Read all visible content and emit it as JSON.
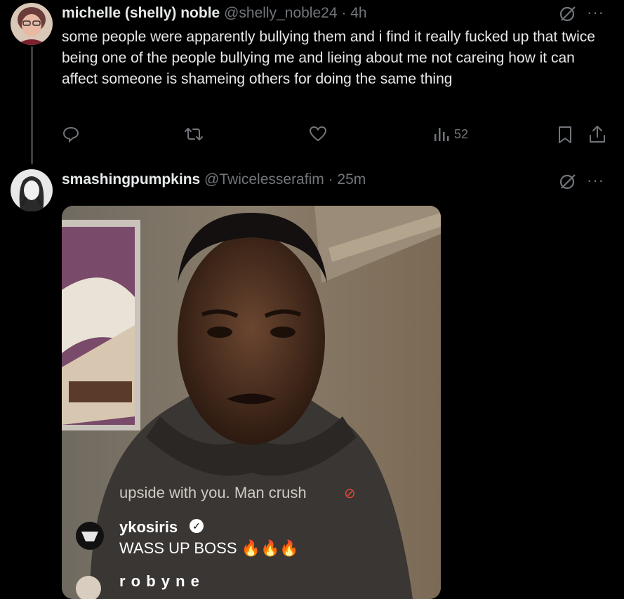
{
  "tweet1": {
    "display_name": "michelle (shelly) noble",
    "handle": "@shelly_noble24",
    "separator": "·",
    "time": "4h",
    "text": "some people were apparently bullying them and i find it really fucked up that twice being one of the people bullying me and lieing about me not careing how it can affect someone is shameing others for doing the same thing",
    "views": "52",
    "icons": [
      "reply-icon",
      "retweet-icon",
      "like-icon",
      "views-icon",
      "bookmark-icon",
      "share-icon",
      "grok-icon",
      "more-icon"
    ]
  },
  "tweet2": {
    "display_name": "smashingpumpkins",
    "handle": "@Twicelesserafim",
    "separator": "·",
    "time": "25m",
    "media": {
      "caption_line": "upside with you. Man crush",
      "comments": [
        {
          "user": "ykosiris",
          "text": "WASS UP BOSS"
        },
        {
          "user": "r o b y n e",
          "text": ""
        }
      ]
    }
  },
  "colors": {
    "background": "#000000",
    "primary_text": "#e7e9ea",
    "secondary_text": "#71767b",
    "thread_line": "#3a3d41"
  }
}
